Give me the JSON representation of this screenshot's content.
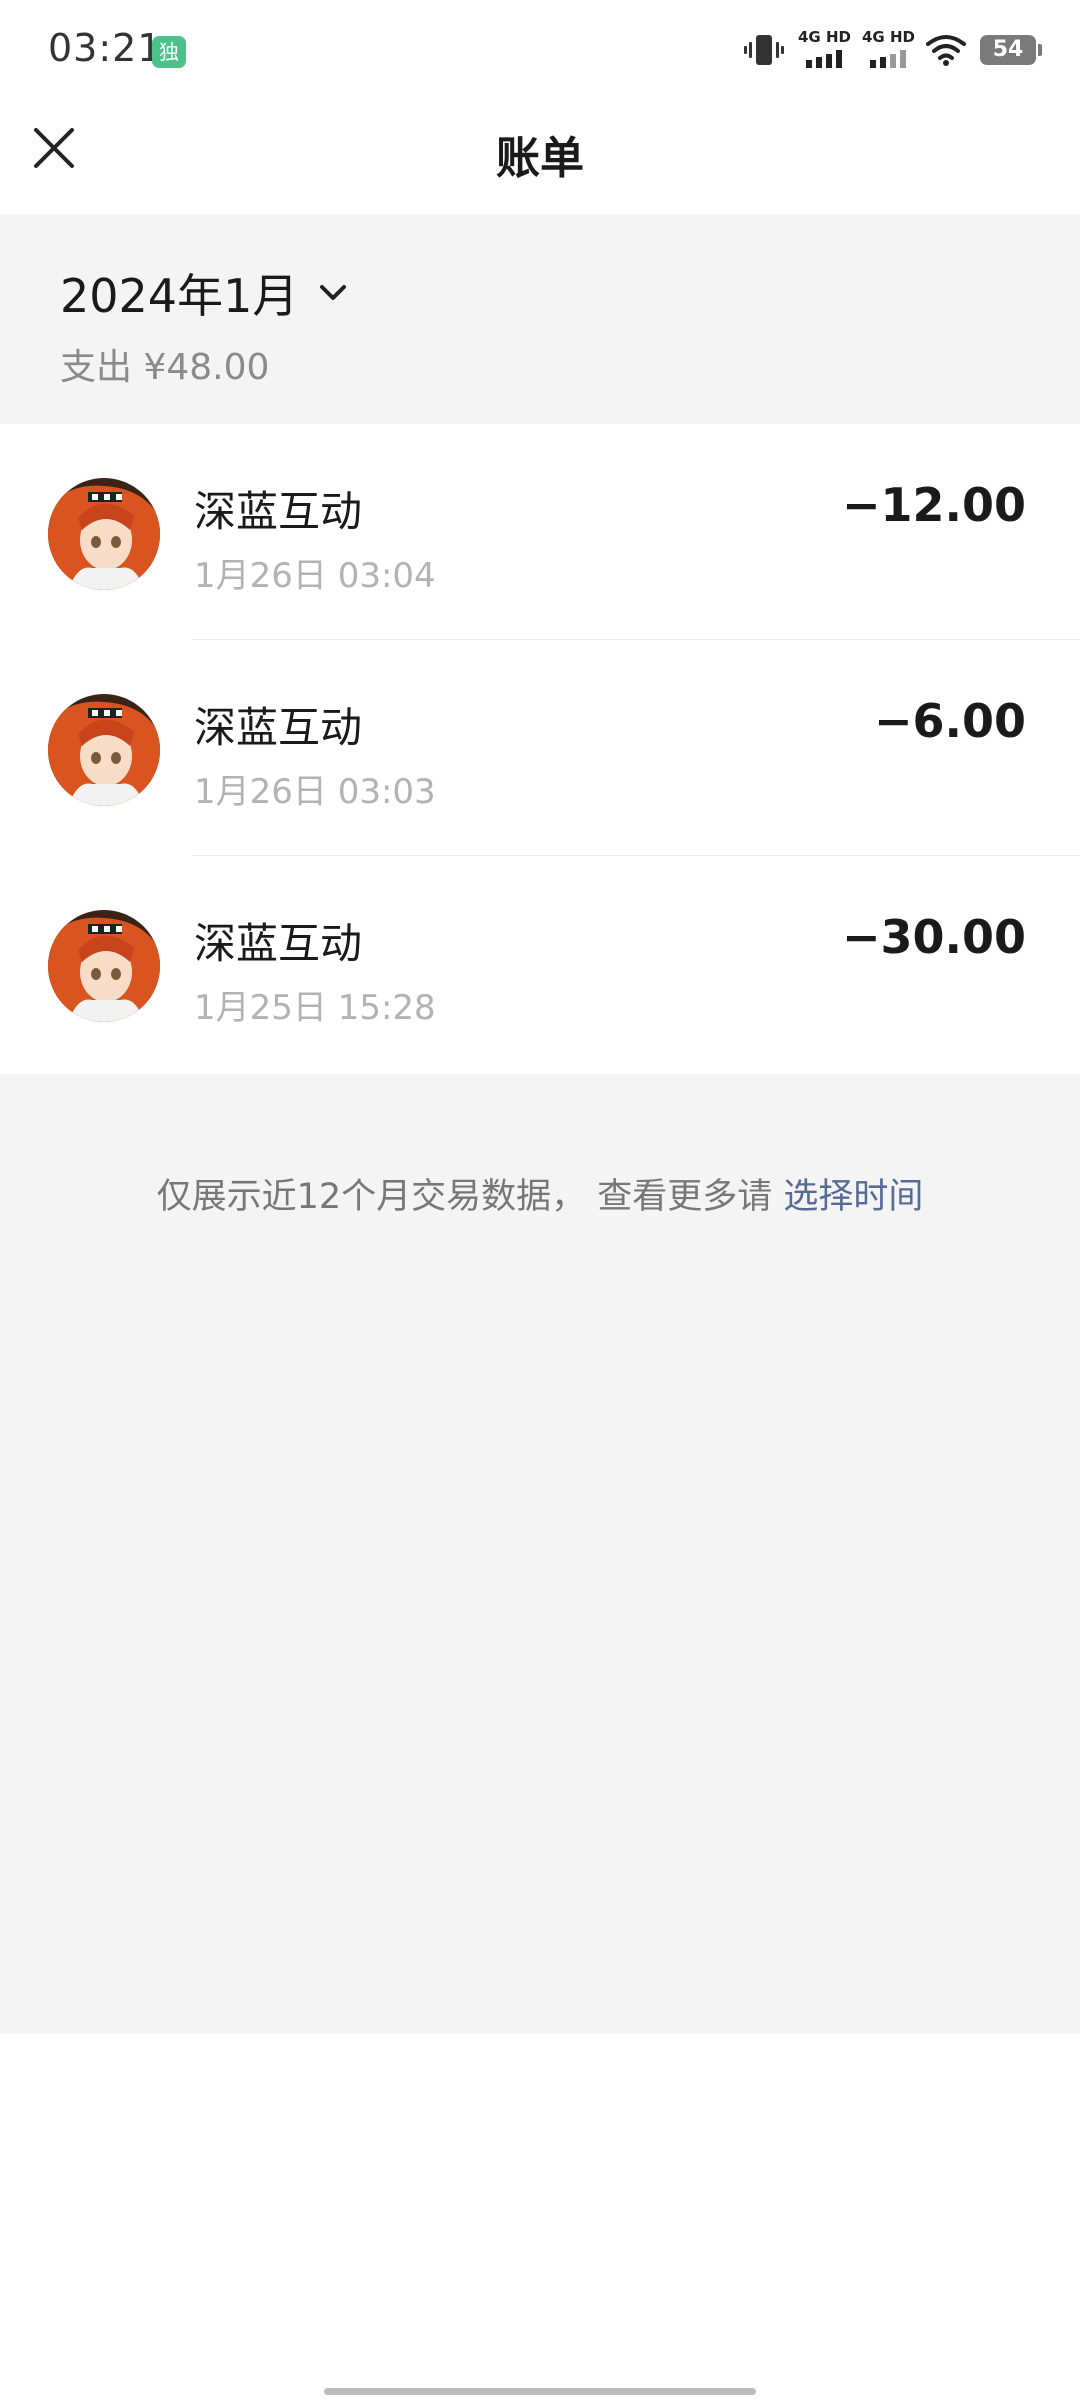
{
  "status_bar": {
    "time": "03:21",
    "app_badge": "独",
    "network_1": "4G HD",
    "network_2": "4G HD",
    "battery": "54",
    "icons": [
      "vibrate-icon",
      "signal-icon",
      "signal-icon",
      "wifi-icon",
      "battery-icon"
    ]
  },
  "header": {
    "title": "账单",
    "close_icon": "close-icon"
  },
  "month": {
    "label": "2024年1月",
    "summary": "支出 ¥48.00",
    "chevron_icon": "chevron-down-icon"
  },
  "transactions": [
    {
      "merchant": "深蓝互动",
      "time": "1月26日 03:04",
      "amount": "−12.00"
    },
    {
      "merchant": "深蓝互动",
      "time": "1月26日 03:03",
      "amount": "−6.00"
    },
    {
      "merchant": "深蓝互动",
      "time": "1月25日 15:28",
      "amount": "−30.00"
    }
  ],
  "footer": {
    "note": "仅展示近12个月交易数据， 查看更多请 ",
    "link": "选择时间"
  },
  "colors": {
    "link": "#576b95",
    "section_bg": "#f4f4f4",
    "badge": "#4cc28a"
  }
}
